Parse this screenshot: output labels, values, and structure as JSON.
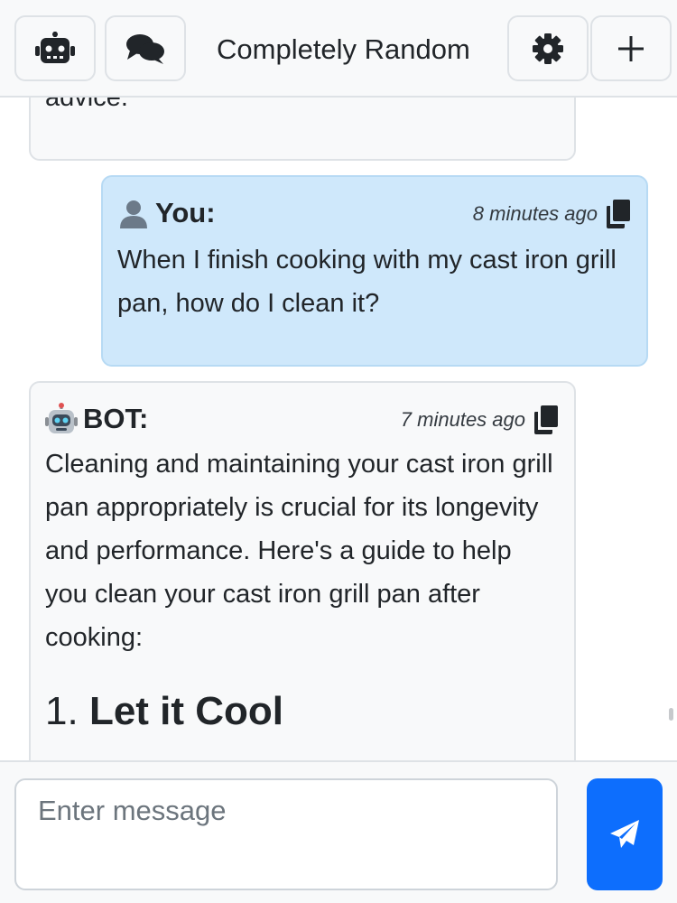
{
  "header": {
    "title": "Completely Random",
    "buttons": {
      "bot": "robot-icon",
      "chats": "comments-icon",
      "settings": "gear-icon",
      "new": "plus-icon"
    }
  },
  "messages": [
    {
      "role": "bot",
      "partial_text": "advice."
    },
    {
      "role": "user",
      "author": "You:",
      "time": "8 minutes ago",
      "text": "When I finish cooking with my cast iron grill pan, how do I clean it?"
    },
    {
      "role": "bot",
      "author": "BOT:",
      "time": "7 minutes ago",
      "text": "Cleaning and maintaining your cast iron grill pan appropriately is crucial for its longevity and performance. Here's a guide to help you clean your cast iron grill pan after cooking:",
      "heading_number": "1.",
      "heading_text": "Let it Cool"
    }
  ],
  "composer": {
    "placeholder": "Enter message",
    "value": "",
    "send_icon": "paper-plane-icon"
  },
  "colors": {
    "accent": "#0d6efd",
    "user_bubble": "#cfe8fb",
    "bot_bubble": "#f8f9fa",
    "border": "#dee2e6"
  }
}
